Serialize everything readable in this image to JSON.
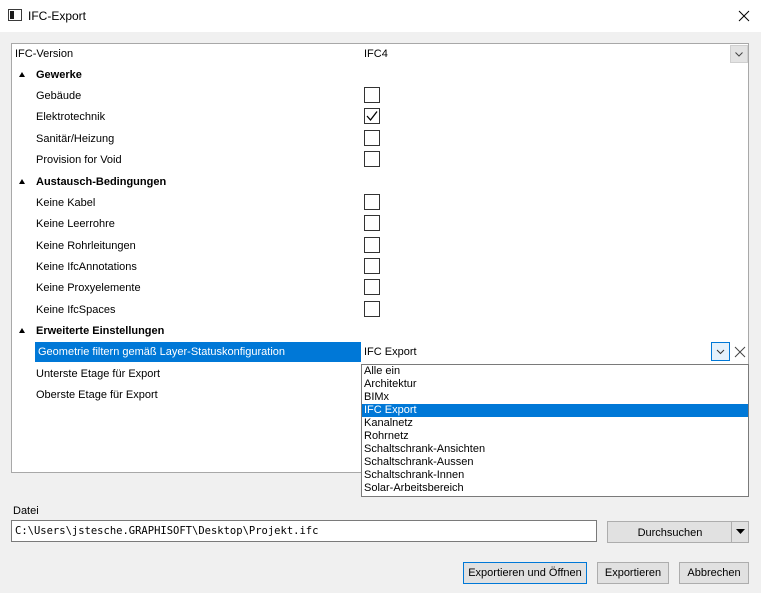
{
  "window": {
    "title": "IFC-Export"
  },
  "ifc_version": {
    "label": "IFC-Version",
    "value": "IFC4"
  },
  "sections": [
    {
      "title": "Gewerke",
      "items": [
        {
          "label": "Gebäude",
          "checked": false
        },
        {
          "label": "Elektrotechnik",
          "checked": true
        },
        {
          "label": "Sanitär/Heizung",
          "checked": false
        },
        {
          "label": "Provision for Void",
          "checked": false
        }
      ]
    },
    {
      "title": "Austausch-Bedingungen",
      "items": [
        {
          "label": "Keine Kabel",
          "checked": false
        },
        {
          "label": "Keine Leerrohre",
          "checked": false
        },
        {
          "label": "Keine Rohrleitungen",
          "checked": false
        },
        {
          "label": "Keine IfcAnnotations",
          "checked": false
        },
        {
          "label": "Keine Proxyelemente",
          "checked": false
        },
        {
          "label": "Keine IfcSpaces",
          "checked": false
        }
      ]
    },
    {
      "title": "Erweiterte Einstellungen",
      "items": [
        {
          "label": "Geometrie filtern gemäß Layer-Statuskonfiguration",
          "value": "IFC Export"
        },
        {
          "label": "Unterste Etage für Export"
        },
        {
          "label": "Oberste Etage für Export"
        }
      ]
    }
  ],
  "layer_dropdown": {
    "selected": "IFC Export",
    "options": [
      "Alle ein",
      "Architektur",
      "BIMx",
      "IFC Export",
      "Kanalnetz",
      "Rohrnetz",
      "Schaltschrank-Ansichten",
      "Schaltschrank-Aussen",
      "Schaltschrank-Innen",
      "Solar-Arbeitsbereich"
    ]
  },
  "file": {
    "label": "Datei",
    "path": "C:\\Users\\jstesche.GRAPHISOFT\\Desktop\\Projekt.ifc",
    "browse_label": "Durchsuchen"
  },
  "footer": {
    "export_open_label": "Exportieren und Öffnen",
    "export_label": "Exportieren",
    "cancel_label": "Abbrechen"
  },
  "colors": {
    "selection": "#0078d7",
    "dialog_bg": "#f0f0f0"
  },
  "icons": {
    "app": "app-icon",
    "close": "close-icon",
    "expand": "collapse-triangle-icon",
    "check": "checkmark-icon",
    "chevron": "chevron-down-icon",
    "clear": "clear-x-icon"
  }
}
